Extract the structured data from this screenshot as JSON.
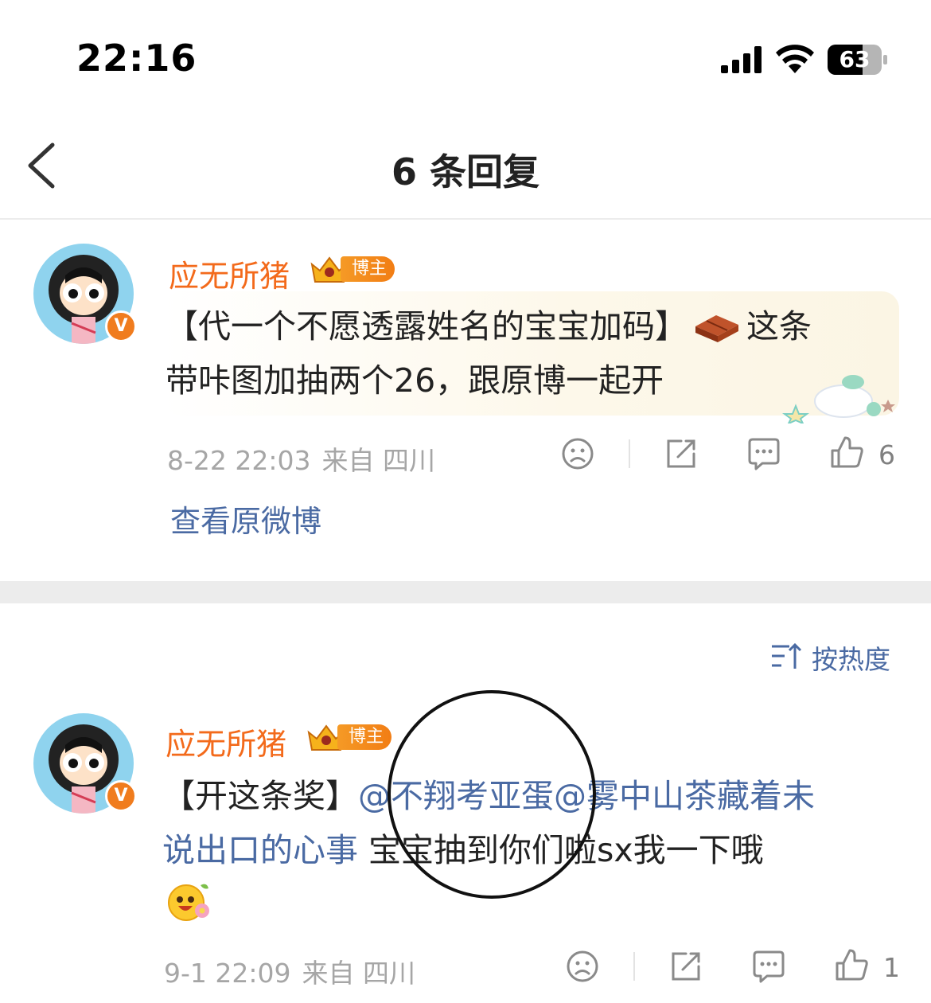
{
  "status_bar": {
    "time": "22:16",
    "battery": "63"
  },
  "nav": {
    "title": "6 条回复",
    "back_icon": "chevron-left-icon"
  },
  "root_comment": {
    "username": "应无所猪",
    "badge": "博主",
    "text_prefix": "【代一个不愿透露姓名的宝宝加码】",
    "text_suffix": "这条",
    "text_line2": "带咔图加抽两个26，跟原博一起开",
    "date": "8-22 22:03",
    "source": "来自 四川",
    "like_count": "6",
    "view_original": "查看原微博"
  },
  "sort": {
    "label": "按热度"
  },
  "reply": {
    "username": "应无所猪",
    "badge": "博主",
    "text_prefix": "【开这条奖】",
    "mention1": "@不翔考亚蛋",
    "mention2": "@雾中山茶藏着未",
    "mention2_cont": "说出口的心事",
    "text_rest": " 宝宝抽到你们啦sx我一下哦",
    "date": "9-1 22:09",
    "source": "来自 四川",
    "like_count": "1"
  },
  "colors": {
    "username": "#f36a1b",
    "link": "#4a6aa3",
    "meta": "#a6a6a6",
    "badge": "#f27d14"
  }
}
